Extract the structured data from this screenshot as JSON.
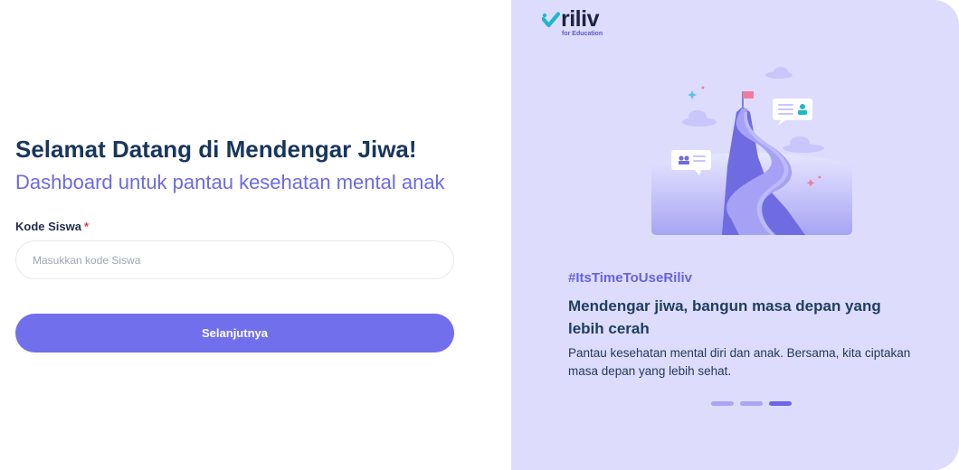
{
  "login": {
    "title": "Selamat Datang di Mendengar Jiwa!",
    "subtitle": "Dashboard untuk pantau kesehatan mental anak",
    "field_label": "Kode Siswa",
    "required_mark": "*",
    "input_value": "",
    "input_placeholder": "Masukkan kode Siswa",
    "submit_label": "Selanjutnya"
  },
  "brand": {
    "name": "riliv",
    "tagline": "for Education"
  },
  "promo": {
    "hashtag": "#ItsTimeToUseRiliv",
    "headline": "Mendengar jiwa, bangun masa depan yang lebih cerah",
    "body": "Pantau kesehatan mental diri dan anak. Bersama, kita ciptakan masa depan yang lebih sehat.",
    "slide_count": 3,
    "active_slide": 3
  },
  "colors": {
    "primary": "#716fec",
    "panel_background": "#dedcfd",
    "title": "#17365d",
    "subtitle": "#6c6ae0",
    "required": "#e0394f",
    "logo_teal": "#1eb7c8"
  }
}
